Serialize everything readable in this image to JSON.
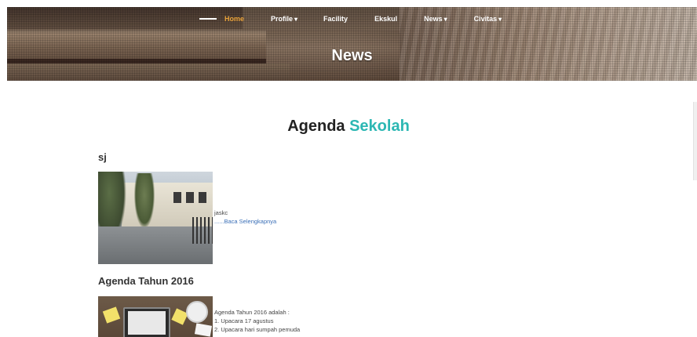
{
  "nav": {
    "items": [
      {
        "label": "Home",
        "active": true,
        "has_caret": false
      },
      {
        "label": "Profile",
        "active": false,
        "has_caret": true
      },
      {
        "label": "Facility",
        "active": false,
        "has_caret": false
      },
      {
        "label": "Ekskul",
        "active": false,
        "has_caret": false
      },
      {
        "label": "News",
        "active": false,
        "has_caret": true
      },
      {
        "label": "Civitas",
        "active": false,
        "has_caret": true
      }
    ],
    "caret": "▾",
    "active_color": "#e8a23a"
  },
  "hero": {
    "title": "News"
  },
  "section": {
    "title_main": "Agenda",
    "title_accent": "Sekolah",
    "accent_color": "#2cb7b3"
  },
  "posts": [
    {
      "title": "sj",
      "excerpt_lines": [
        "jaskc"
      ],
      "read_more": "......Baca Selengkapnya"
    },
    {
      "title": "Agenda Tahun 2016",
      "excerpt_lines": [
        "Agenda Tahun 2016 adalah :",
        "1. Upacara 17 agustus",
        "2. Upacara hari sumpah pemuda"
      ]
    }
  ],
  "colors": {
    "link": "#3a6fb7"
  }
}
